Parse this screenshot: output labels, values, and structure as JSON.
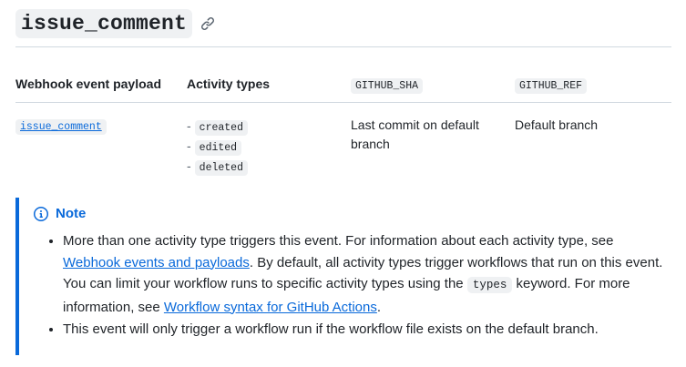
{
  "heading": {
    "title": "issue_comment",
    "link_icon": "link-icon"
  },
  "table": {
    "headers": [
      "Webhook event payload",
      "Activity types",
      "GITHUB_SHA",
      "GITHUB_REF"
    ],
    "row": {
      "payload": "issue_comment",
      "activity_types": [
        "created",
        "edited",
        "deleted"
      ],
      "github_sha": "Last commit on default branch",
      "github_ref": "Default branch"
    }
  },
  "note": {
    "icon": "info-icon",
    "title": "Note",
    "bullet1": {
      "text_a": "More than one activity type triggers this event. For information about each activity type, see ",
      "link1": "Webhook events and payloads",
      "text_b": ". By default, all activity types trigger workflows that run on this event. You can limit your workflow runs to specific activity types using the ",
      "code": "types",
      "text_c": " keyword. For more information, see ",
      "link2": "Workflow syntax for GitHub Actions",
      "text_d": "."
    },
    "bullet2": "This event will only trigger a workflow run if the workflow file exists on the default branch."
  },
  "colors": {
    "accent": "#0969da",
    "text": "#1f2328",
    "code_bg": "#eff1f3",
    "border": "#d1d9e0"
  }
}
